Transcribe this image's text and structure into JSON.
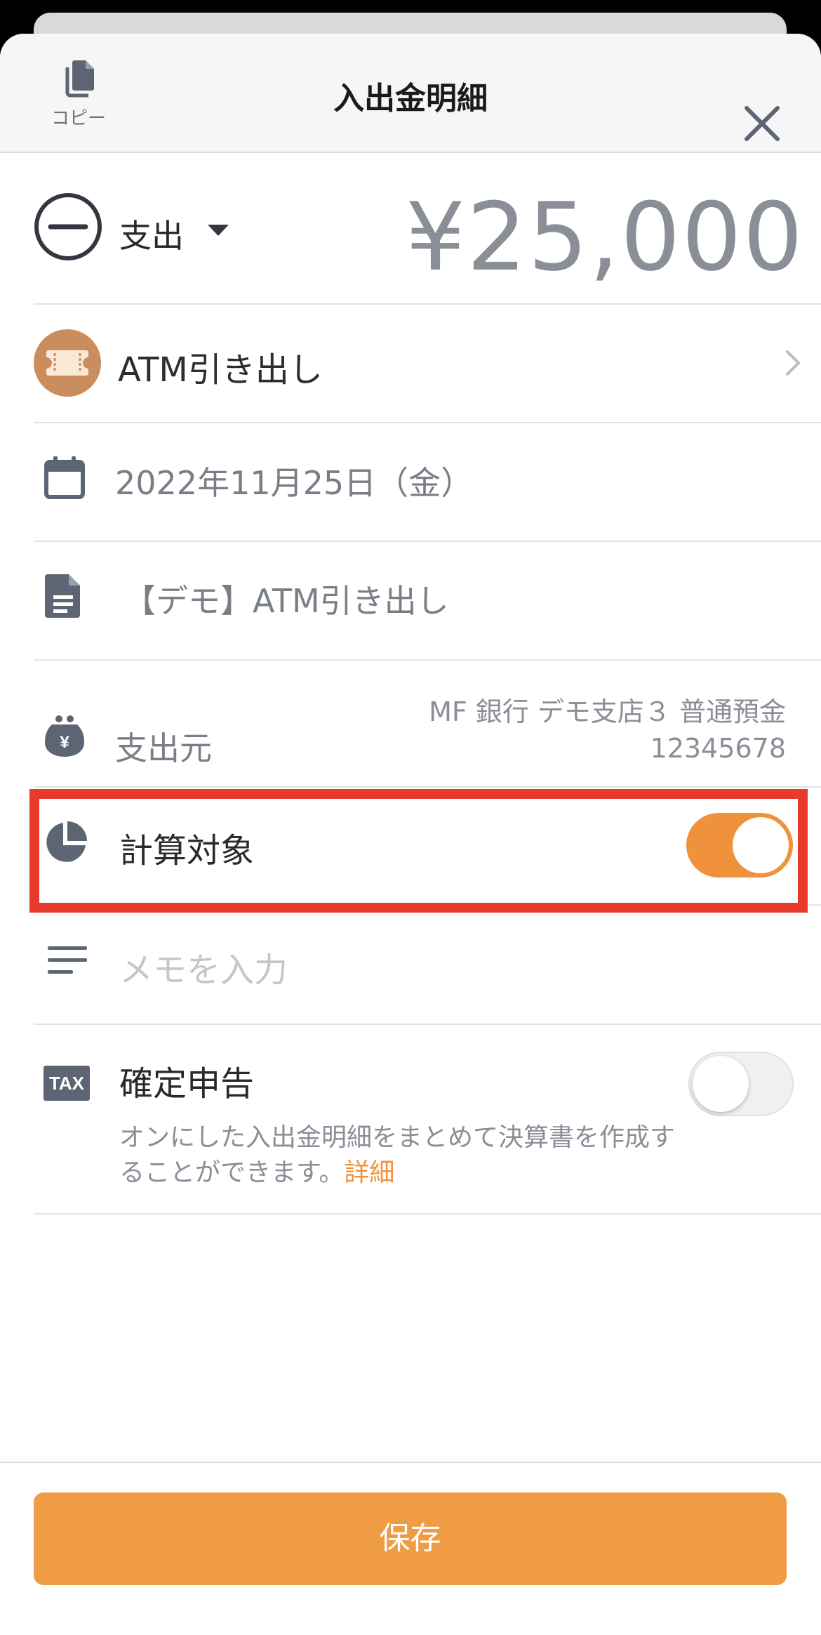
{
  "header": {
    "copy_label": "コピー",
    "title": "入出金明細"
  },
  "transaction": {
    "type_label": "支出",
    "amount": "¥25,000",
    "category": "ATM引き出し",
    "date": "2022年11月25日（金）",
    "content": "【デモ】ATM引き出し",
    "source_label": "支出元",
    "source_account_line1": "MF 銀行 デモ支店３ 普通預金",
    "source_account_line2": "12345678"
  },
  "calculation": {
    "label": "計算対象",
    "enabled": true
  },
  "memo": {
    "placeholder": "メモを入力"
  },
  "tax": {
    "badge": "TAX",
    "title": "確定申告",
    "description": "オンにした入出金明細をまとめて決算書を作成することができます。",
    "link_label": "詳細",
    "enabled": false
  },
  "footer": {
    "save_label": "保存"
  },
  "colors": {
    "accent": "#f0923b",
    "highlight": "#e63a2c",
    "icon": "#5d6575",
    "category_icon": "#c98d5e"
  }
}
